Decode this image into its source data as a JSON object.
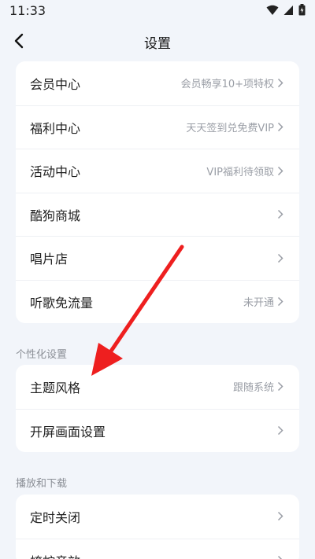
{
  "status_bar": {
    "time": "11:33"
  },
  "header": {
    "title": "设置"
  },
  "group1": {
    "items": [
      {
        "label": "会员中心",
        "value": "会员畅享10+项特权"
      },
      {
        "label": "福利中心",
        "value": "天天签到兑免费VIP"
      },
      {
        "label": "活动中心",
        "value": "VIP福利待领取"
      },
      {
        "label": "酷狗商城",
        "value": ""
      },
      {
        "label": "唱片店",
        "value": ""
      },
      {
        "label": "听歌免流量",
        "value": "未开通"
      }
    ]
  },
  "personalization": {
    "section_title": "个性化设置",
    "items": [
      {
        "label": "主题风格",
        "value": "跟随系统"
      },
      {
        "label": "开屏画面设置",
        "value": ""
      }
    ]
  },
  "playback": {
    "section_title": "播放和下载",
    "items": [
      {
        "label": "定时关闭",
        "value": ""
      },
      {
        "label": "蝰蛇音效",
        "value": ""
      }
    ]
  },
  "colors": {
    "annotation_arrow": "#ee1f1f",
    "background": "#f2f5fa"
  }
}
